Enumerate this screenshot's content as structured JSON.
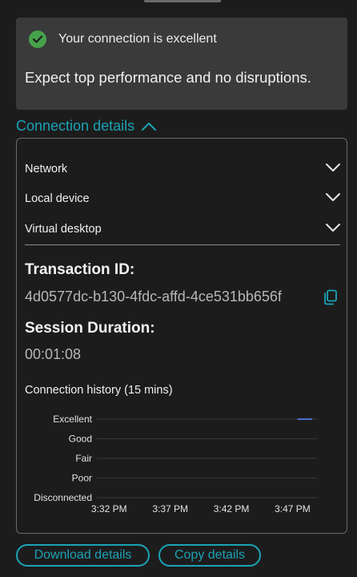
{
  "status": {
    "title": "Your connection is excellent",
    "description": "Expect top performance and no disruptions.",
    "icon": "check-circle-icon",
    "icon_color": "#46a24a"
  },
  "details": {
    "toggle_label": "Connection details",
    "expanded": true,
    "accent_color": "#1ba3b5",
    "sections": [
      {
        "label": "Network"
      },
      {
        "label": "Local device"
      },
      {
        "label": "Virtual desktop"
      }
    ],
    "transaction_label": "Transaction ID:",
    "transaction_id": "4d0577dc-b130-4fdc-affd-4ce531bb656f",
    "duration_label": "Session Duration:",
    "duration_value": "00:01:08",
    "history_title": "Connection history (15 mins)"
  },
  "chart_data": {
    "type": "line",
    "y_categories": [
      "Excellent",
      "Good",
      "Fair",
      "Poor",
      "Disconnected"
    ],
    "x_ticks": [
      "3:32 PM",
      "3:37 PM",
      "3:42 PM",
      "3:47 PM"
    ],
    "series": [
      {
        "color": "#4a6fd1",
        "points": [
          {
            "x": "3:48 PM",
            "y": "Excellent"
          }
        ]
      }
    ],
    "grid": true
  },
  "actions": {
    "download_label": "Download details",
    "copy_label": "Copy details"
  }
}
